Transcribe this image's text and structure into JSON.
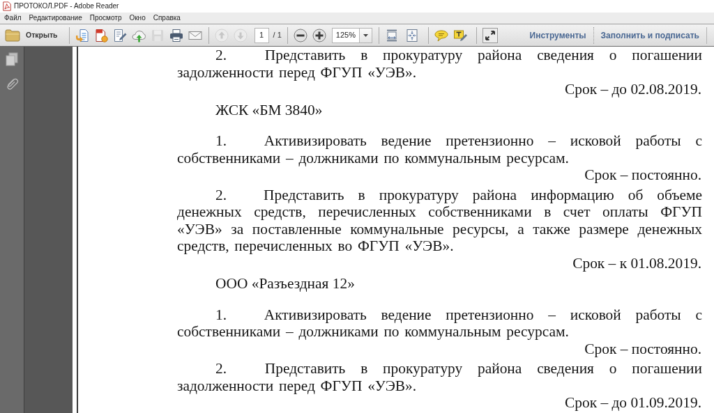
{
  "window": {
    "title": "ПРОТОКОЛ.PDF - Adobe Reader"
  },
  "menu": [
    "Файл",
    "Редактирование",
    "Просмотр",
    "Окно",
    "Справка"
  ],
  "toolbar": {
    "open_button": "Открыть",
    "file_tools": [
      {
        "kind": "create",
        "disabled": false
      },
      {
        "kind": "convert",
        "disabled": false
      },
      {
        "kind": "sign",
        "disabled": false
      },
      {
        "kind": "upload",
        "disabled": false
      },
      {
        "kind": "save",
        "disabled": true
      },
      {
        "kind": "print",
        "disabled": false
      },
      {
        "kind": "mail",
        "disabled": false
      }
    ],
    "page_nav": [
      {
        "kind": "previous",
        "disabled": true
      },
      {
        "kind": "next",
        "disabled": true
      }
    ],
    "page_number": {
      "value": "1"
    },
    "page_count": "/ 1",
    "zoom": {
      "value": "125%"
    },
    "tools_button": "Инструменты",
    "fill_sign_button": "Заполнить и подписать"
  },
  "document": {
    "blocks": [
      {
        "kind": "paragraph",
        "number": "2.",
        "text": "Представить в прокуратуру района сведения о погашении задолженности перед ФГУП «УЭВ»."
      },
      {
        "kind": "deadline",
        "text": "Срок – до 02.08.2019."
      },
      {
        "kind": "heading",
        "text": "ЖСК «БМ 3840»"
      },
      {
        "kind": "paragraph",
        "number": "1.",
        "text": "Активизировать ведение претензионно – исковой работы с собственниками – должниками по коммунальным ресурсам."
      },
      {
        "kind": "deadline",
        "text": "Срок – постоянно."
      },
      {
        "kind": "paragraph",
        "number": "2.",
        "text": "Представить в прокуратуру района информацию об объеме денежных средств, перечисленных собственниками в счет оплаты ФГУП «УЭВ» за поставленные коммунальные ресурсы, а также размере денежных средств, перечисленных во ФГУП «УЭВ»."
      },
      {
        "kind": "deadline",
        "text": "Срок – к 01.08.2019."
      },
      {
        "kind": "heading",
        "text": "ООО «Разъездная 12»"
      },
      {
        "kind": "paragraph",
        "number": "1.",
        "text": "Активизировать ведение претензионно – исковой работы с собственниками – должниками по коммунальным ресурсам."
      },
      {
        "kind": "deadline",
        "text": "Срок – постоянно."
      },
      {
        "kind": "paragraph",
        "number": "2.",
        "text": "Представить в прокуратуру района сведения о погашении задолженности перед ФГУП «УЭВ»."
      },
      {
        "kind": "deadline",
        "text": "Срок – до 01.09.2019."
      }
    ]
  }
}
